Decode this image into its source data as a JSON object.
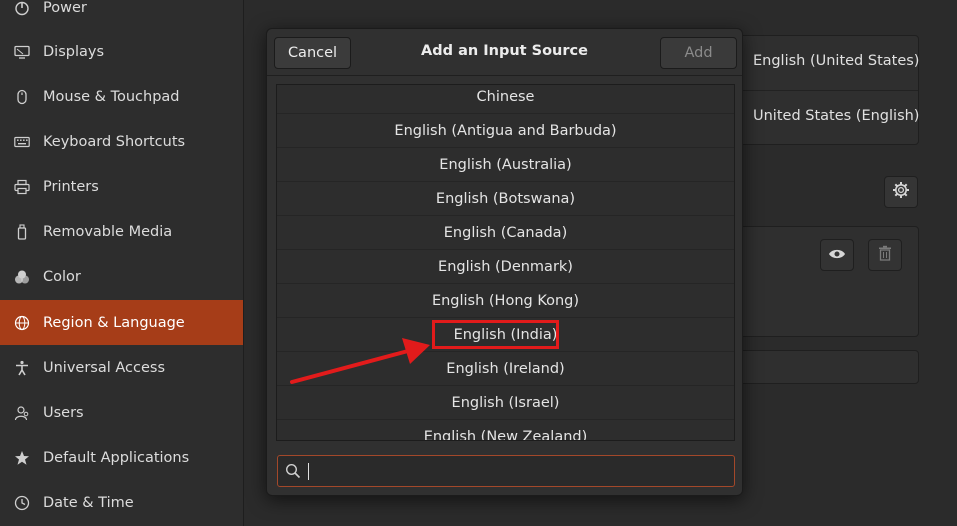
{
  "sidebar": {
    "items": [
      {
        "label": "Power",
        "icon": "power-icon",
        "active": false
      },
      {
        "label": "Displays",
        "icon": "display-icon",
        "active": false
      },
      {
        "label": "Mouse & Touchpad",
        "icon": "mouse-icon",
        "active": false
      },
      {
        "label": "Keyboard Shortcuts",
        "icon": "keyboard-icon",
        "active": false
      },
      {
        "label": "Printers",
        "icon": "printer-icon",
        "active": false
      },
      {
        "label": "Removable Media",
        "icon": "usb-drive-icon",
        "active": false
      },
      {
        "label": "Color",
        "icon": "color-icon",
        "active": false
      },
      {
        "label": "Region & Language",
        "icon": "globe-icon",
        "active": true
      },
      {
        "label": "Universal Access",
        "icon": "accessibility-icon",
        "active": false
      },
      {
        "label": "Users",
        "icon": "users-icon",
        "active": false
      },
      {
        "label": "Default Applications",
        "icon": "star-icon",
        "active": false
      },
      {
        "label": "Date & Time",
        "icon": "clock-icon",
        "active": false
      }
    ]
  },
  "background": {
    "language_value": "English (United States)",
    "formats_value": "United States (English)",
    "icons": [
      "settings-gear-icon",
      "eye-icon",
      "trash-icon"
    ]
  },
  "dialog": {
    "cancel_label": "Cancel",
    "title": "Add an Input Source",
    "add_label": "Add",
    "rows": [
      "Chinese",
      "English (Antigua and Barbuda)",
      "English (Australia)",
      "English (Botswana)",
      "English (Canada)",
      "English (Denmark)",
      "English (Hong Kong)",
      "English (India)",
      "English (Ireland)",
      "English (Israel)",
      "English (New Zealand)"
    ],
    "search": {
      "value": "",
      "placeholder": ""
    }
  },
  "colors": {
    "accent": "#a63d18",
    "annotation_red": "#e21b1b"
  }
}
